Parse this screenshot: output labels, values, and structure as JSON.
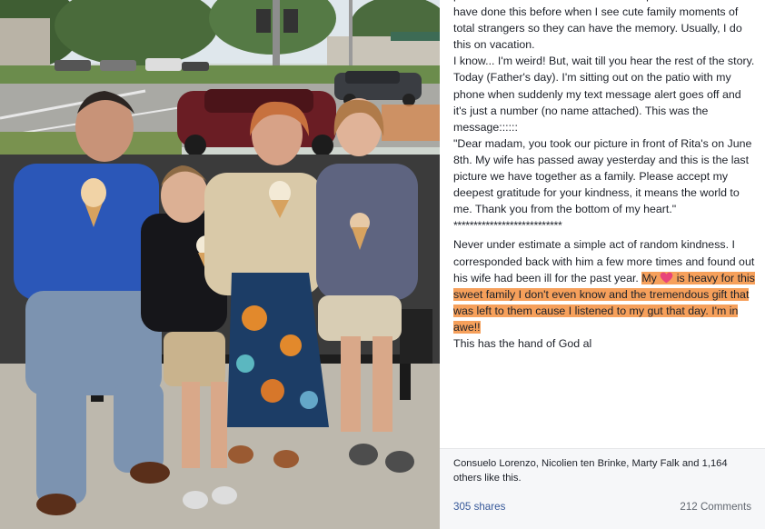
{
  "post": {
    "paragraph1": "phone. Left to take Blake home and explained to him how I have done this before when I see cute family moments of total strangers so they can have the memory. Usually, I do this on vacation.",
    "paragraph2": "I know... I'm weird! But, wait till you hear the rest of the story. Today (Father's day). I'm sitting out on the patio with my phone when suddenly my text message alert goes off and it's just a number (no name attached). This was the message::::::",
    "quote": "\"Dear madam, you took our picture in front of Rita's on June 8th. My wife has passed away yesterday and this is the last picture we have together as a family. Please accept my deepest gratitude for your kindness, it means the world to me. Thank you from the bottom of my heart.\"",
    "separator": "***************************",
    "paragraph3_plain": "Never under estimate a simple act of random kindness. I corresponded back with him a few more times and found out his wife had been ill for the past year.",
    "highlight_my": "My",
    "highlight_rest": "is heavy for this sweet family I don't even know and the tremendous gift that was left to them cause I listened to my gut that day. I'm in awe!!",
    "paragraph4": "This has the hand of God al"
  },
  "reactions": {
    "likes_text": "Consuelo Lorenzo, Nicolien ten Brinke, Marty Falk and 1,164 others like this.",
    "shares": "305 shares",
    "comments": "212 Comments"
  },
  "colors": {
    "highlight": "#f6a05b",
    "heart": "#e8457a",
    "link": "#365899",
    "muted": "#616770"
  },
  "icons": {
    "heart": "heart-emoji-icon"
  }
}
